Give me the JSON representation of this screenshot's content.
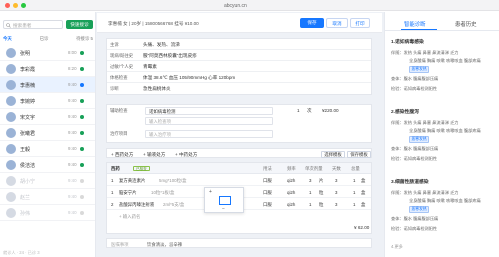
{
  "browser": {
    "url": "abcyun.cn",
    "dots": [
      "#ff5f57",
      "#febc2e",
      "#28c840"
    ]
  },
  "left": {
    "search_placeholder": "搜索患者",
    "register_label": "快速接诊",
    "tabs": [
      "今天",
      "已诊",
      "待接诊 5"
    ],
    "patients": [
      {
        "name": "张明",
        "time": "8:00",
        "status": "#18a058"
      },
      {
        "name": "李彩霞",
        "time": "8:20",
        "status": "#18a058"
      },
      {
        "name": "李惠楠",
        "time": "9:40",
        "status": "#1677ff"
      },
      {
        "name": "李婉婷",
        "time": "9:40",
        "status": "#18a058"
      },
      {
        "name": "宋文宇",
        "time": "9:40",
        "status": "#18a058"
      },
      {
        "name": "张曦君",
        "time": "9:40",
        "status": "#18a058"
      },
      {
        "name": "王毅",
        "time": "9:40",
        "status": "#18a058"
      },
      {
        "name": "侯洁洁",
        "time": "9:40",
        "status": "#18a058"
      },
      {
        "name": "胡小宁",
        "time": "9:40",
        "status": "#d9d9d9"
      },
      {
        "name": "赵兰",
        "time": "9:40",
        "status": "#d9d9d9"
      },
      {
        "name": "孙伟",
        "time": "9:40",
        "status": "#d9d9d9"
      }
    ],
    "footer": "就诊人 · 24 · 已诊 3"
  },
  "middle": {
    "patient_info": "李惠楠    女 | 20岁 | 15800566768    挂号 ¥10.00",
    "save_label": "保存",
    "cancel_label": "取消",
    "print_label": "打印",
    "form": [
      {
        "label": "主诉",
        "value": "头痛、发热、流涕"
      },
      {
        "label": "现病/既往史",
        "value": "服\"阿莫西林胶囊\"出现皮疹"
      },
      {
        "label": "过敏/个人史",
        "value": "青霉素"
      },
      {
        "label": "体格检查",
        "value": "体温 38.6℃  血压 105/90mmHg  心率 120bpm"
      },
      {
        "label": "诊断",
        "value": "急性扁桃体炎"
      }
    ],
    "diagnosis": {
      "check_label": "辅助检查",
      "check_value": "诺如病毒检测",
      "check_qty": "1",
      "check_unit": "次",
      "check_price": "¥220.00",
      "check_placeholder": "输入检查项",
      "treat_label": "治疗项目",
      "treat_placeholder": "输入治疗项"
    },
    "rx_bar": {
      "western": "+ 西药处方",
      "infusion": "+ 输液处方",
      "chinese": "+ 中药处方",
      "template": "选择模板",
      "save_template": "保存模板"
    },
    "rx": {
      "header": [
        "西药",
        "用法",
        "频率",
        "单次剂量",
        "天数",
        "总量"
      ],
      "tag": "已核查",
      "rows": [
        {
          "name": "复方黄连素片",
          "spec": "5mg*100粒/盒",
          "route": "口服",
          "freq": "qi2h",
          "dose": "3",
          "dose_unit": "片",
          "days": "3",
          "total": "1",
          "unit": "盒"
        },
        {
          "name": "脑安宁片",
          "spec": "10粒*1板/盒",
          "route": "口服",
          "freq": "qi2h",
          "dose": "1",
          "dose_unit": "粒",
          "days": "3",
          "total": "1",
          "unit": "盒"
        },
        {
          "name": "盐酸异丙嗪注射液",
          "spec": "2ml*5支/盒",
          "route": "口服",
          "freq": "qi2h",
          "dose": "1",
          "dose_unit": "粒",
          "days": "3",
          "total": "1",
          "unit": "盒"
        }
      ],
      "add_placeholder": "+ 输入药名",
      "total": "¥ 62.00",
      "stepper_plus": "+",
      "stepper_minus": "−"
    },
    "bottom": {
      "left": "医嘱事项",
      "right": "饮食清淡，忌辛辣"
    }
  },
  "right": {
    "tab_active": "智能诊断",
    "tab_other": "患者历史",
    "sections": [
      {
        "title": "1.诺如病毒感染",
        "lines": [
          "伴随：发热  头痛  鼻塞  鼻流清涕  乏力",
          "全身酸痛  胸痛  咳嗽  咳嗽咳血  腹部疼痛",
          "恶寒发热",
          "查体：腹水  腹痛腹部压痛",
          "检验：诺如病毒检测阳性"
        ]
      },
      {
        "title": "2.感染性腹泻",
        "lines": [
          "伴随：发热  头痛  鼻塞  鼻流清涕  乏力",
          "全身酸痛  胸痛  咳嗽  咳嗽咳血  腹部疼痛",
          "恶寒发热",
          "查体：腹水  腹痛腹部压痛",
          "检验：诺如病毒检测阳性"
        ]
      },
      {
        "title": "3.细菌性肠道感染",
        "lines": [
          "伴随：发热  头痛  鼻塞  鼻流清涕  乏力",
          "全身酸痛  胸痛  咳嗽  咳嗽咳血  腹部疼痛",
          "恶寒发热",
          "查体：腹水  腹痛腹部压痛",
          "检验：诺如病毒检测阳性"
        ]
      }
    ],
    "footer": "4.更多"
  }
}
